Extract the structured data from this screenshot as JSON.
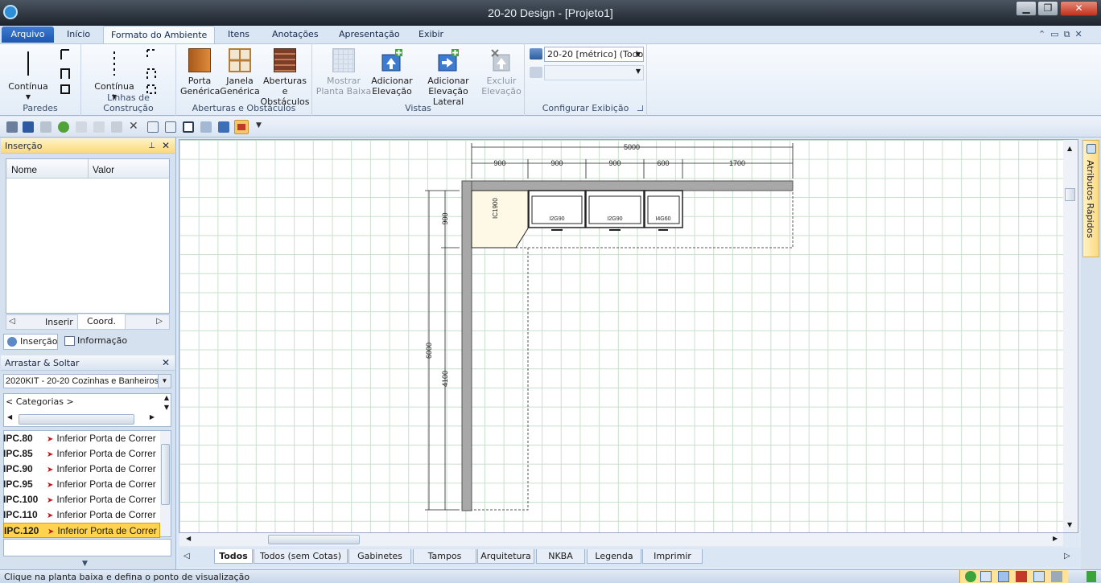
{
  "window": {
    "title": "20-20 Design - [Projeto1]",
    "min": "▁",
    "max": "❐",
    "close": "✕"
  },
  "ribbon_tabs": {
    "arquivo": "Arquivo",
    "inicio": "Início",
    "formato": "Formato do Ambiente",
    "itens": "Itens",
    "anotacoes": "Anotações",
    "apresentacao": "Apresentação",
    "exibir": "Exibir"
  },
  "ribbon": {
    "paredes": {
      "label": "Paredes",
      "continua": "Contínua"
    },
    "linhas": {
      "label": "Linhas de Construção",
      "continua": "Contínua"
    },
    "aberturas": {
      "label": "Aberturas e Obstáculos",
      "porta1": "Porta",
      "porta2": "Genérica",
      "janela1": "Janela",
      "janela2": "Genérica",
      "aberturas1": "Aberturas e",
      "aberturas2": "Obstáculos"
    },
    "vistas": {
      "label": "Vistas",
      "mostrar1": "Mostrar",
      "mostrar2": "Planta Baixa",
      "adicionar1": "Adicionar",
      "adicionar2": "Elevação",
      "adicionarlat1": "Adicionar",
      "adicionarlat2": "Elevação Lateral",
      "excluir1": "Excluir",
      "excluir2": "Elevação"
    },
    "config": {
      "label": "Configurar Exibição",
      "dropdown": "20-20 [métrico] (Todo"
    }
  },
  "insercao_panel": {
    "title": "Inserção",
    "col_nome": "Nome",
    "col_valor": "Valor",
    "tab_inserir": "Inserir",
    "tab_coord": "Coord.",
    "bottom_insercao": "Inserção",
    "bottom_informacao": "Informação"
  },
  "arrastar": {
    "title": "Arrastar & Soltar",
    "catalog": "2020KIT - 20-20 Cozinhas e Banheiros",
    "categorias": "< Categorias >"
  },
  "items": [
    {
      "code": "IPC.80",
      "desc": "Inferior Porta de Correr"
    },
    {
      "code": "IPC.85",
      "desc": "Inferior Porta de Correr"
    },
    {
      "code": "IPC.90",
      "desc": "Inferior Porta de Correr"
    },
    {
      "code": "IPC.95",
      "desc": "Inferior Porta de Correr"
    },
    {
      "code": "IPC.100",
      "desc": "Inferior Porta de Correr"
    },
    {
      "code": "IPC.110",
      "desc": "Inferior Porta de Correr"
    },
    {
      "code": "IPC.120",
      "desc": "Inferior Porta de Correr",
      "selected": true
    }
  ],
  "drawing": {
    "dims_top": [
      "5000",
      "900",
      "900",
      "900",
      "600",
      "1700"
    ],
    "dims_left": [
      "900",
      "6000",
      "4100"
    ],
    "cabinets": [
      "IC1900",
      "I2G90",
      "I2G90",
      "I4G60"
    ]
  },
  "right_panel": {
    "label": "Atributos Rápidos"
  },
  "bottom_tabs": [
    "Todos",
    "Todos (sem Cotas)",
    "Gabinetes",
    "Tampos",
    "Arquitetura",
    "NKBA",
    "Legenda",
    "Imprimir"
  ],
  "status": {
    "text": "Clique na planta baixa e defina o ponto de visualização"
  },
  "colors": {
    "accent": "#1d57b0",
    "selected": "#ffd34d",
    "grid": "#c9dfcd",
    "wall": "#a8a8a8"
  }
}
